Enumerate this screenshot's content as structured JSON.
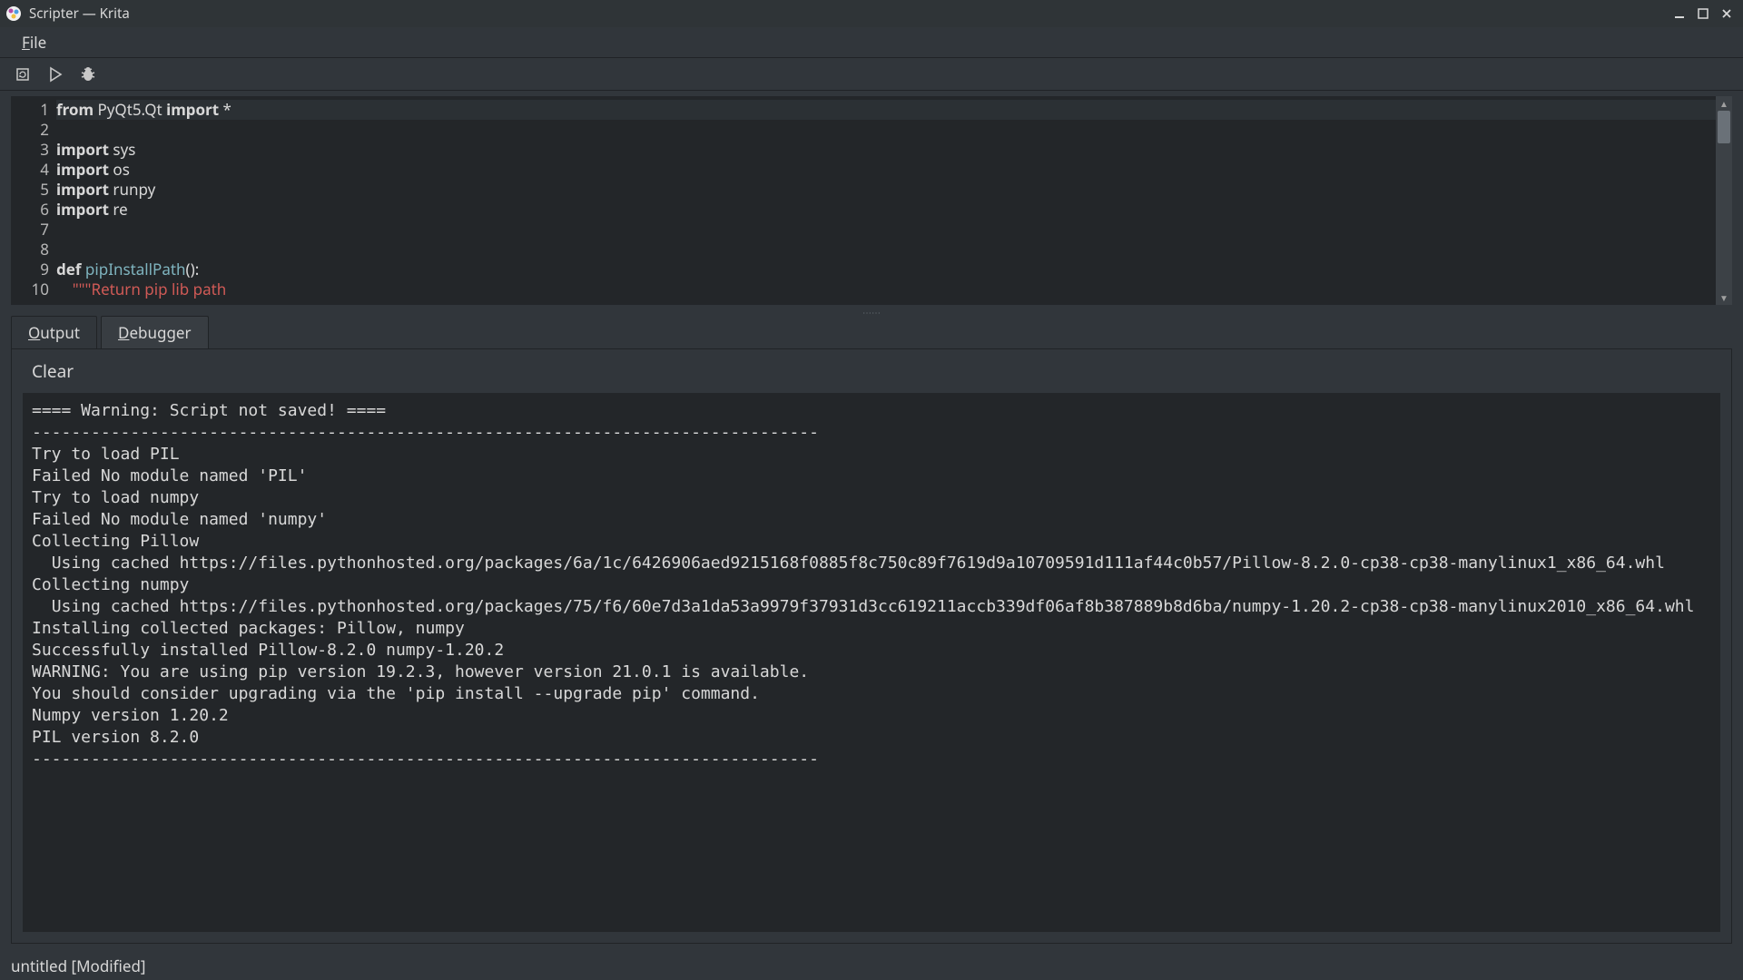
{
  "window": {
    "title": "Scripter — Krita"
  },
  "menubar": {
    "file": {
      "accel": "F",
      "rest": "ile"
    }
  },
  "code": {
    "line_numbers": [
      "1",
      "2",
      "3",
      "4",
      "5",
      "6",
      "7",
      "8",
      "9",
      "10"
    ],
    "lines": [
      {
        "segs": [
          {
            "t": "from",
            "cls": "kw"
          },
          {
            "t": " PyQt5.Qt "
          },
          {
            "t": "import",
            "cls": "kw"
          },
          {
            "t": " *"
          }
        ],
        "current": true
      },
      {
        "segs": []
      },
      {
        "segs": [
          {
            "t": "import",
            "cls": "kw"
          },
          {
            "t": " sys"
          }
        ]
      },
      {
        "segs": [
          {
            "t": "import",
            "cls": "kw"
          },
          {
            "t": " os"
          }
        ]
      },
      {
        "segs": [
          {
            "t": "import",
            "cls": "kw"
          },
          {
            "t": " runpy"
          }
        ]
      },
      {
        "segs": [
          {
            "t": "import",
            "cls": "kw"
          },
          {
            "t": " re"
          }
        ]
      },
      {
        "segs": []
      },
      {
        "segs": []
      },
      {
        "segs": [
          {
            "t": "def ",
            "cls": "kw"
          },
          {
            "t": "pipInstallPath",
            "cls": "fname"
          },
          {
            "t": "():"
          }
        ]
      },
      {
        "segs": [
          {
            "t": "    "
          },
          {
            "t": "\"\"\"Return pip lib path",
            "cls": "str"
          }
        ]
      }
    ]
  },
  "tabs": {
    "output": {
      "accel": "O",
      "rest": "utput"
    },
    "debugger": {
      "accel": "D",
      "rest": "ebugger"
    }
  },
  "output": {
    "clear_label": "Clear",
    "text": "==== Warning: Script not saved! ====\n--------------------------------------------------------------------------------\nTry to load PIL\nFailed No module named 'PIL'\nTry to load numpy\nFailed No module named 'numpy'\nCollecting Pillow\n  Using cached https://files.pythonhosted.org/packages/6a/1c/6426906aed9215168f0885f8c750c89f7619d9a10709591d111af44c0b57/Pillow-8.2.0-cp38-cp38-manylinux1_x86_64.whl\nCollecting numpy\n  Using cached https://files.pythonhosted.org/packages/75/f6/60e7d3a1da53a9979f37931d3cc619211accb339df06af8b387889b8d6ba/numpy-1.20.2-cp38-cp38-manylinux2010_x86_64.whl\nInstalling collected packages: Pillow, numpy\nSuccessfully installed Pillow-8.2.0 numpy-1.20.2\nWARNING: You are using pip version 19.2.3, however version 21.0.1 is available.\nYou should consider upgrading via the 'pip install --upgrade pip' command.\nNumpy version 1.20.2\nPIL version 8.2.0\n--------------------------------------------------------------------------------"
  },
  "statusbar": {
    "text": "untitled [Modified]"
  }
}
